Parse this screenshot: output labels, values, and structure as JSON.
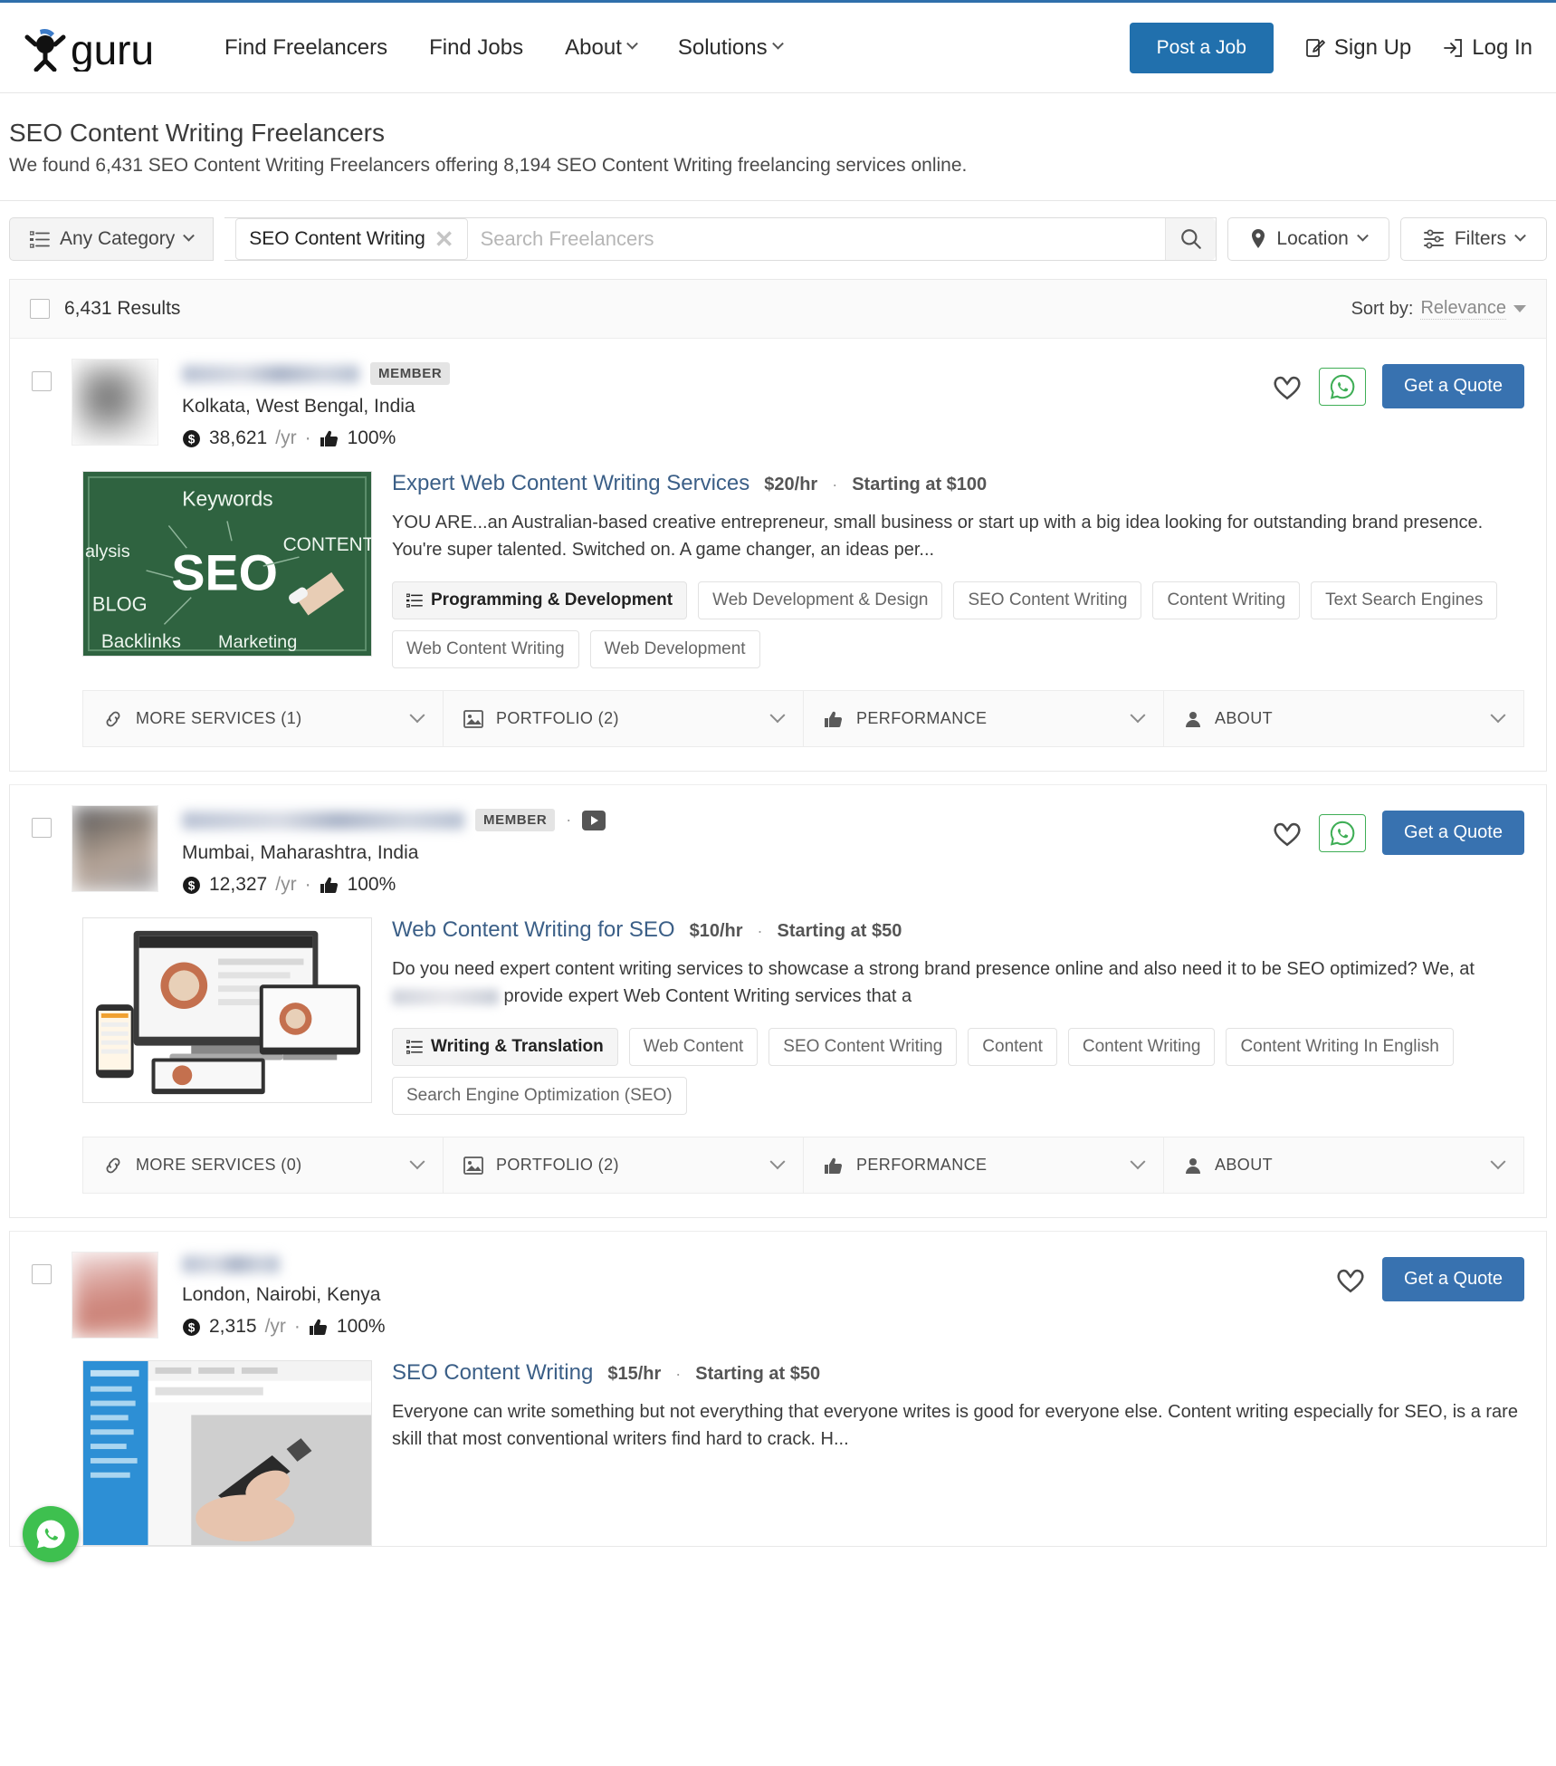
{
  "brand": {
    "name": "guru",
    "accent": "#2170ad"
  },
  "nav": {
    "items": [
      {
        "label": "Find Freelancers",
        "caret": false
      },
      {
        "label": "Find Jobs",
        "caret": false
      },
      {
        "label": "About",
        "caret": true
      },
      {
        "label": "Solutions",
        "caret": true
      }
    ],
    "post_job": "Post a Job",
    "sign_up": "Sign Up",
    "log_in": "Log In"
  },
  "page": {
    "title": "SEO Content Writing Freelancers",
    "subtitle": "We found 6,431 SEO Content Writing Freelancers offering 8,194 SEO Content Writing freelancing services online."
  },
  "search": {
    "category_label": "Any Category",
    "chip": "SEO Content Writing",
    "placeholder": "Search Freelancers",
    "value": "",
    "location_label": "Location",
    "filters_label": "Filters"
  },
  "results": {
    "count_label": "6,431 Results",
    "sort_prefix": "Sort by:",
    "sort_value": "Relevance"
  },
  "labels": {
    "member": "MEMBER",
    "get_quote": "Get a Quote",
    "per_year": "/yr",
    "dot": "·"
  },
  "accordion_labels": {
    "more_services": "MORE SERVICES",
    "portfolio": "PORTFOLIO",
    "performance": "PERFORMANCE",
    "about": "ABOUT"
  },
  "freelancers": [
    {
      "name_blurred": true,
      "badge": "MEMBER",
      "has_video": false,
      "location": "Kolkata, West Bengal, India",
      "earnings": "38,621",
      "per": "/yr",
      "feedback": "100%",
      "has_whatsapp": true,
      "quote_label": "Get a Quote",
      "service": {
        "title": "Expert Web Content Writing Services",
        "rate": "$20/hr",
        "starting": "Starting at $100",
        "description": "YOU ARE...an Australian-based creative entrepreneur, small business or start up with a big idea looking for outstanding brand presence. You're super talented. Switched on. A game changer, an ideas per...",
        "primary_tag": "Programming & Development",
        "tags": [
          "Web Development & Design",
          "SEO Content Writing",
          "Content Writing",
          "Text Search Engines",
          "Web Content Writing",
          "Web Development"
        ],
        "image_kind": "seo-chalkboard"
      },
      "accordion": {
        "more_services": "MORE SERVICES (1)",
        "portfolio": "PORTFOLIO (2)",
        "performance": "PERFORMANCE",
        "about": "ABOUT"
      }
    },
    {
      "name_blurred": true,
      "badge": "MEMBER",
      "has_video": true,
      "location": "Mumbai, Maharashtra, India",
      "earnings": "12,327",
      "per": "/yr",
      "feedback": "100%",
      "has_whatsapp": true,
      "quote_label": "Get a Quote",
      "service": {
        "title": "Web Content Writing for SEO",
        "rate": "$10/hr",
        "starting": "Starting at $50",
        "description_pre": "Do you need expert content writing services to showcase a strong brand presence online and also need it to be SEO optimized? We, at ",
        "description_post": " provide expert Web Content Writing services that a",
        "primary_tag": "Writing & Translation",
        "tags": [
          "Web Content",
          "SEO Content Writing",
          "Content",
          "Content Writing",
          "Content Writing In English",
          "Search Engine Optimization (SEO)"
        ],
        "image_kind": "devices-mockup"
      },
      "accordion": {
        "more_services": "MORE SERVICES (0)",
        "portfolio": "PORTFOLIO (2)",
        "performance": "PERFORMANCE",
        "about": "ABOUT"
      }
    },
    {
      "name_blurred": true,
      "badge": "",
      "has_video": false,
      "location": "London, Nairobi, Kenya",
      "earnings": "2,315",
      "per": "/yr",
      "feedback": "100%",
      "has_whatsapp": false,
      "quote_label": "Get a Quote",
      "service": {
        "title": "SEO Content Writing",
        "rate": "$15/hr",
        "starting": "Starting at $50",
        "description": "Everyone can write something but not everything that everyone writes is good for everyone else. Content writing especially for SEO, is a rare skill that most conventional writers find hard to crack. H...",
        "image_kind": "dashboard-pen"
      }
    }
  ]
}
